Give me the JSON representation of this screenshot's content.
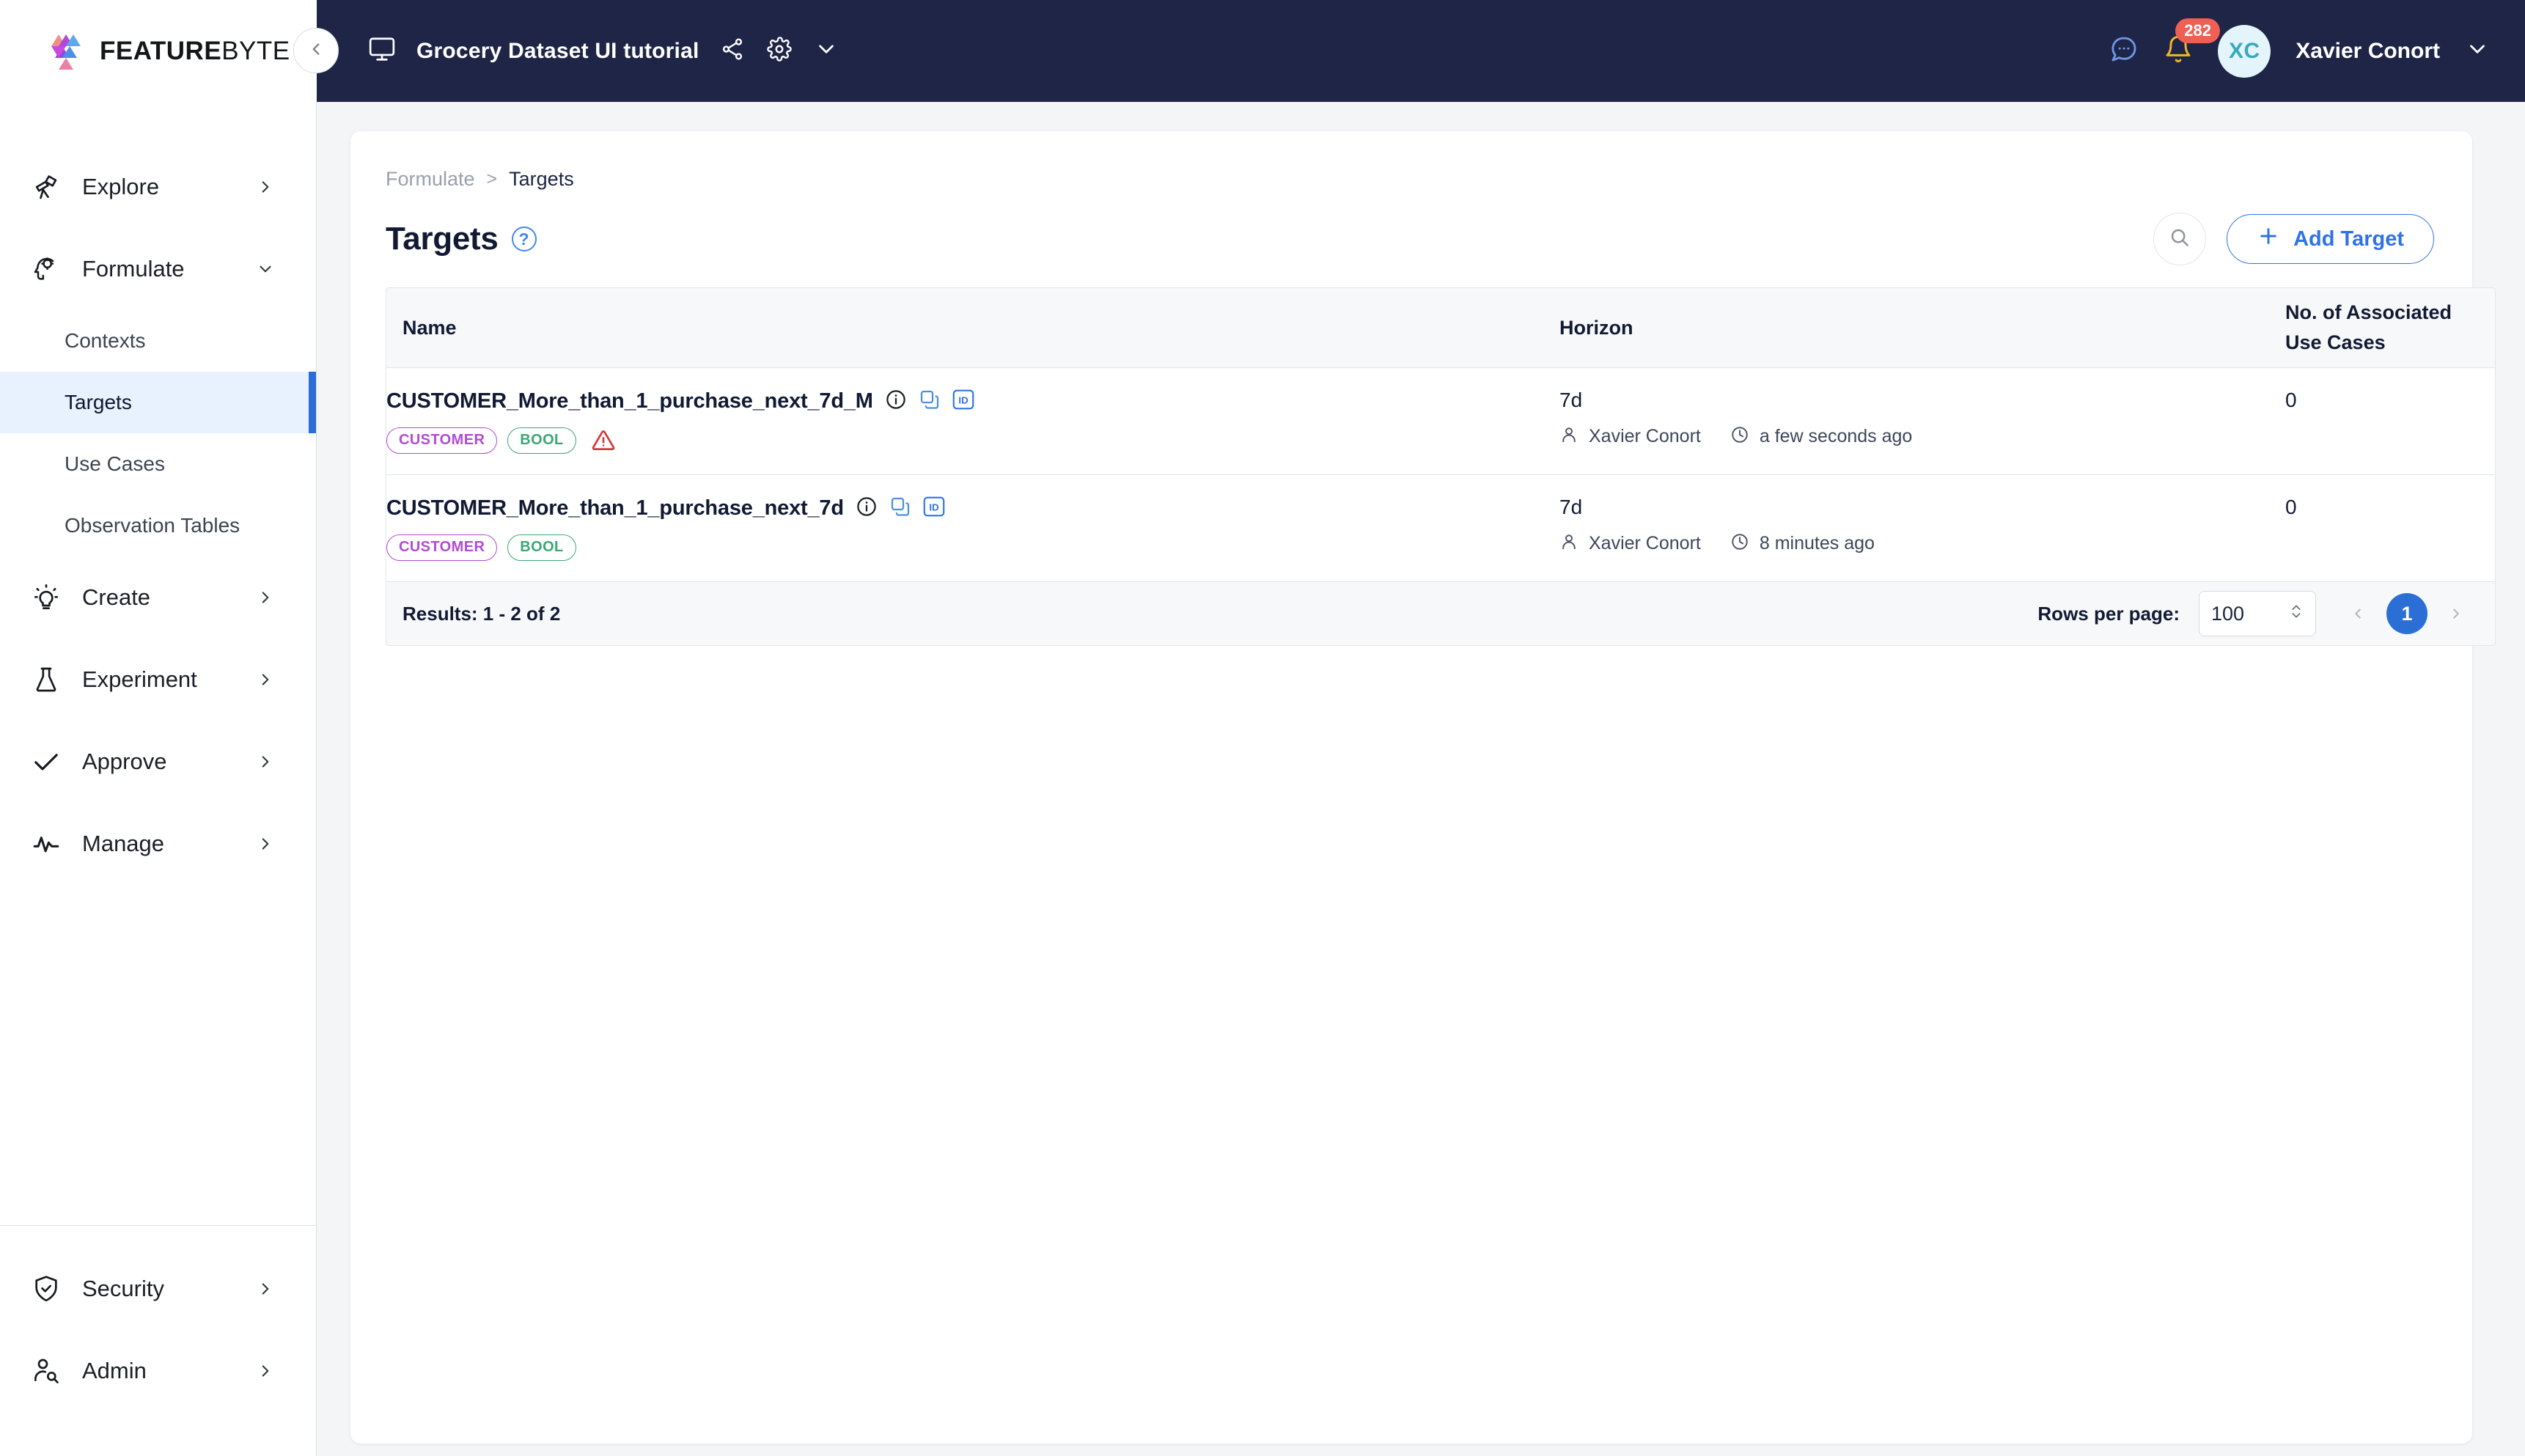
{
  "topbar": {
    "logo_text_bold": "FEATURE",
    "logo_text_light": "BYTE",
    "collapse_icon": "chevron-left-icon",
    "project_name": "Grocery Dataset UI tutorial",
    "monitor_icon": "monitor-icon",
    "share_icon": "share-icon",
    "settings_icon": "gear-icon",
    "project_dropdown_icon": "chevron-down-icon",
    "chat_icon": "chat-icon",
    "bell_icon": "bell-icon",
    "notification_count": "282",
    "avatar_initials": "XC",
    "user_name": "Xavier Conort",
    "user_dropdown_icon": "chevron-down-icon"
  },
  "sidebar": {
    "groups": [
      {
        "label": "Explore",
        "icon": "telescope-icon",
        "chevron": "chevron-right-icon",
        "expanded": false
      },
      {
        "label": "Formulate",
        "icon": "head-gear-icon",
        "chevron": "chevron-down-icon",
        "expanded": true
      },
      {
        "label": "Create",
        "icon": "lightbulb-icon",
        "chevron": "chevron-right-icon",
        "expanded": false
      },
      {
        "label": "Experiment",
        "icon": "flask-icon",
        "chevron": "chevron-right-icon",
        "expanded": false
      },
      {
        "label": "Approve",
        "icon": "check-icon",
        "chevron": "chevron-right-icon",
        "expanded": false
      },
      {
        "label": "Manage",
        "icon": "pulse-icon",
        "chevron": "chevron-right-icon",
        "expanded": false
      }
    ],
    "formulate_children": [
      {
        "label": "Contexts",
        "active": false
      },
      {
        "label": "Targets",
        "active": true
      },
      {
        "label": "Use Cases",
        "active": false
      },
      {
        "label": "Observation Tables",
        "active": false
      }
    ],
    "bottom": [
      {
        "label": "Security",
        "icon": "shield-check-icon",
        "chevron": "chevron-right-icon"
      },
      {
        "label": "Admin",
        "icon": "user-search-icon",
        "chevron": "chevron-right-icon"
      }
    ]
  },
  "main": {
    "breadcrumb": {
      "parent": "Formulate",
      "separator": ">",
      "current": "Targets"
    },
    "page_title": "Targets",
    "help_glyph": "?",
    "search_icon": "search-icon",
    "add_button": {
      "label": "Add Target",
      "plus_icon": "plus-icon"
    },
    "table": {
      "columns": [
        {
          "key": "name",
          "label": "Name"
        },
        {
          "key": "horizon",
          "label": "Horizon"
        },
        {
          "key": "cases",
          "label": "No. of Associated\nUse Cases",
          "line1": "No. of Associated",
          "line2": "Use Cases"
        }
      ],
      "rows": [
        {
          "name": "CUSTOMER_More_than_1_purchase_next_7d_M",
          "info_icon": "info-icon",
          "copy_icon": "copy-icon",
          "id_icon": "id-icon",
          "tags": [
            {
              "text": "CUSTOMER",
              "kind": "customer"
            },
            {
              "text": "BOOL",
              "kind": "bool"
            }
          ],
          "warning_icon": "warning-triangle-icon",
          "has_warning": true,
          "horizon": "7d",
          "author_icon": "person-icon",
          "author": "Xavier Conort",
          "time_icon": "clock-icon",
          "time": "a few seconds ago",
          "cases": "0"
        },
        {
          "name": "CUSTOMER_More_than_1_purchase_next_7d",
          "info_icon": "info-icon",
          "copy_icon": "copy-icon",
          "id_icon": "id-icon",
          "tags": [
            {
              "text": "CUSTOMER",
              "kind": "customer"
            },
            {
              "text": "BOOL",
              "kind": "bool"
            }
          ],
          "has_warning": false,
          "horizon": "7d",
          "author_icon": "person-icon",
          "author": "Xavier Conort",
          "time_icon": "clock-icon",
          "time": "8 minutes ago",
          "cases": "0"
        }
      ],
      "footer": {
        "results": "Results: 1 - 2 of 2",
        "rows_per_page_label": "Rows per page:",
        "rows_per_page_value": "100",
        "stepper_icon": "updown-chevron-icon",
        "prev_icon": "chevron-left-icon",
        "next_icon": "chevron-right-icon",
        "current_page": "1"
      }
    }
  },
  "colors": {
    "topbar_bg": "#1e2546",
    "accent_blue": "#2b6fd6",
    "link_blue": "#2f72e8",
    "tag_purple": "#b34ad4",
    "tag_green": "#3aa872",
    "warning_red": "#cf3b38",
    "badge_red": "#ef5f54",
    "avatar_bg": "#e3f5fa",
    "avatar_fg": "#3aa8c1",
    "page_bg": "#f4f5f7"
  }
}
